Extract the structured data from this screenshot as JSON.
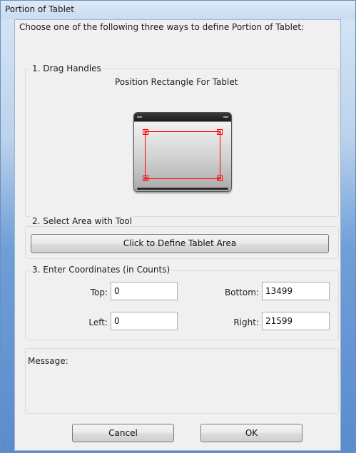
{
  "window": {
    "title": "Portion of Tablet"
  },
  "instruction": "Choose one of the following three ways to define Portion of Tablet:",
  "section1": {
    "label": "1. Drag Handles",
    "caption": "Position Rectangle For Tablet"
  },
  "section2": {
    "label": "2. Select Area with Tool",
    "button_label": "Click to Define Tablet Area"
  },
  "section3": {
    "label": "3. Enter Coordinates (in Counts)",
    "top_label": "Top:",
    "top_value": "0",
    "left_label": "Left:",
    "left_value": "0",
    "bottom_label": "Bottom:",
    "bottom_value": "13499",
    "right_label": "Right:",
    "right_value": "21599"
  },
  "message": {
    "label": "Message:",
    "text": ""
  },
  "buttons": {
    "cancel_label": "Cancel",
    "ok_label": "OK"
  }
}
